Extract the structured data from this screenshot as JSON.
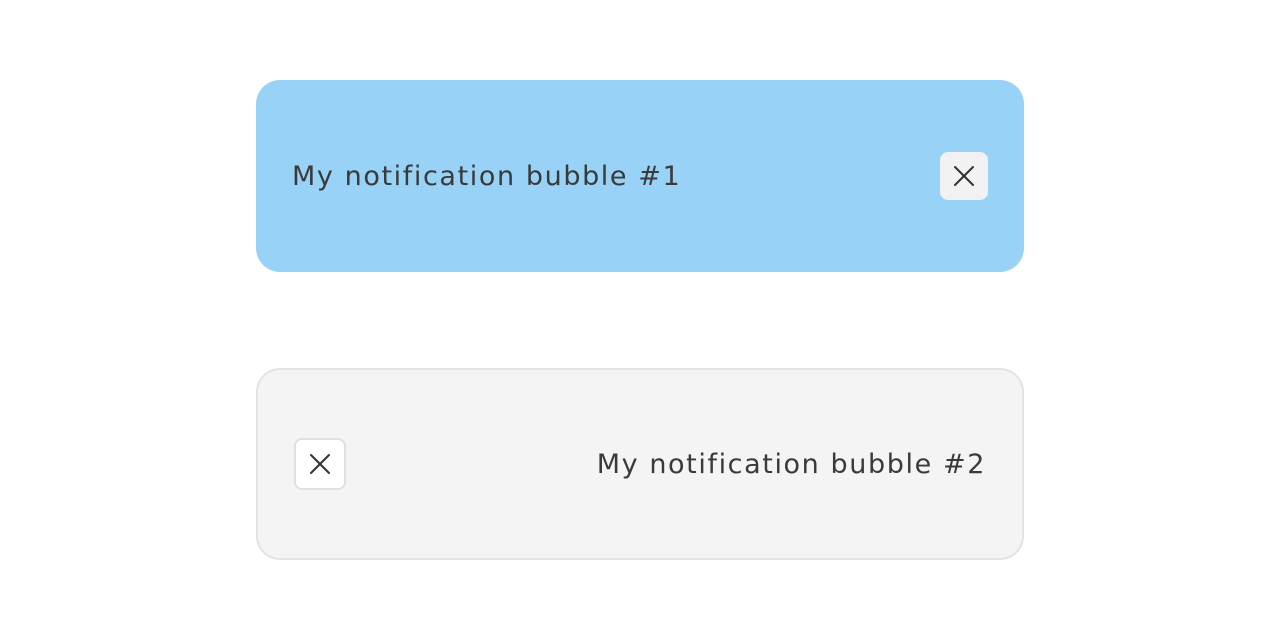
{
  "notifications": [
    {
      "message": "My notification bubble #1",
      "background": "#98d2f6",
      "close_icon": "close-icon"
    },
    {
      "message": "My notification bubble #2",
      "background": "#f4f4f4",
      "close_icon": "close-icon"
    }
  ]
}
